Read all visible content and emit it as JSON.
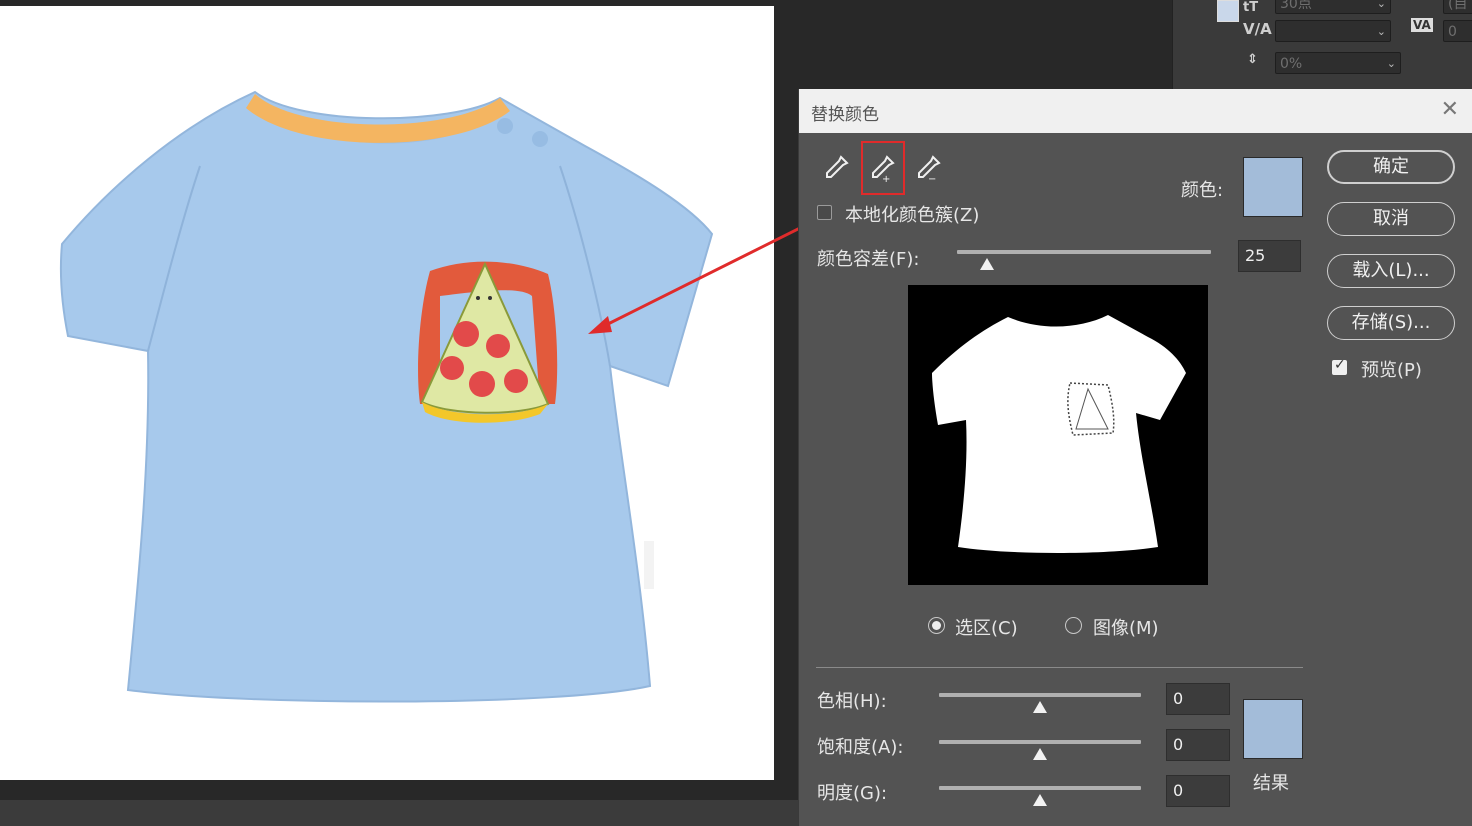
{
  "char_panel": {
    "field_top_value": "30点",
    "tracking_icon": "V/A",
    "kerning_icon": "VA",
    "kerning_value": "0",
    "scale_value": "0%",
    "top_right_partial": "(自"
  },
  "dialog": {
    "title": "替换颜色",
    "localized_clusters_label": "本地化颜色簇(Z)",
    "localized_clusters_checked": false,
    "fuzziness_label": "颜色容差(F):",
    "fuzziness_value": "25",
    "fuzziness_fraction": 0.12,
    "color_label": "颜色:",
    "selected_color": "#a3bcd9",
    "buttons": {
      "ok": "确定",
      "cancel": "取消",
      "load": "载入(L)...",
      "save": "存储(S)..."
    },
    "preview_label": "预览(P)",
    "preview_checked": true,
    "radio_selection": "选区(C)",
    "radio_image": "图像(M)",
    "selected_radio": "selection",
    "hue_label": "色相(H):",
    "hue_value": "0",
    "saturation_label": "饱和度(A):",
    "saturation_value": "0",
    "lightness_label": "明度(G):",
    "lightness_value": "0",
    "result_label": "结果",
    "result_color": "#a3bcd9",
    "tools": [
      "eyedropper-icon",
      "eyedropper-plus-icon",
      "eyedropper-minus-icon"
    ],
    "highlighted_tool": "eyedropper-plus-icon"
  },
  "colors": {
    "shirt": "#a7c9ec",
    "collar": "#f4b561",
    "annotation_red": "#e02b2b"
  }
}
